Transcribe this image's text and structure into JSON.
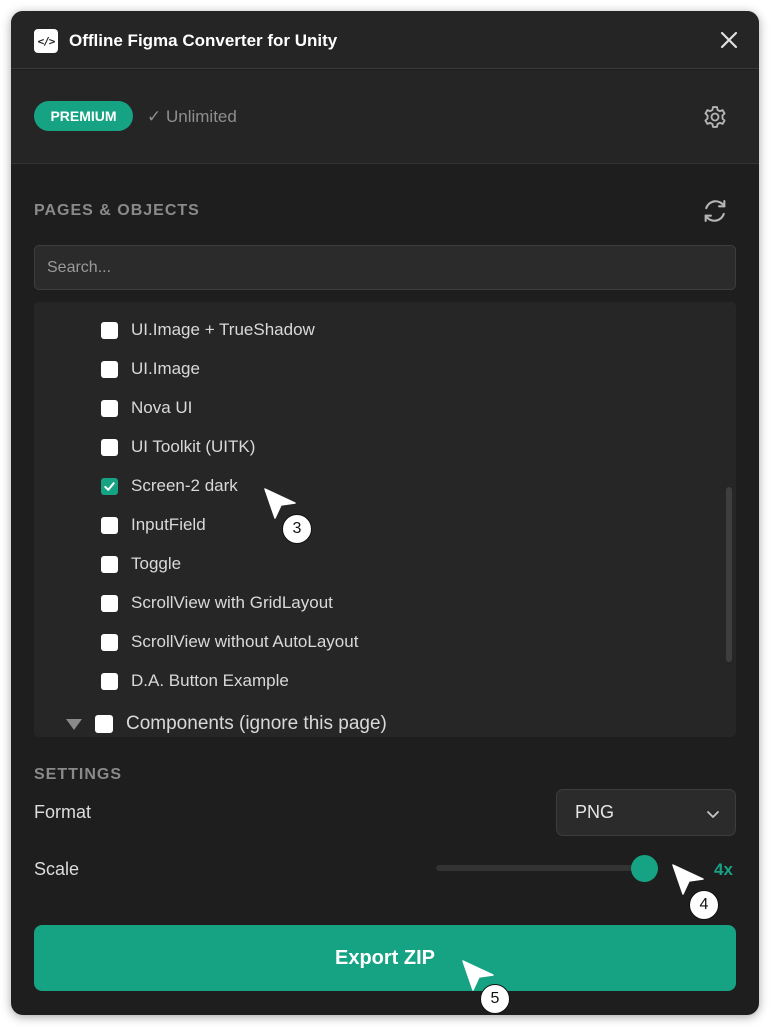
{
  "app": {
    "title": "Offline Figma Converter for Unity",
    "icon_glyph": "</>"
  },
  "license": {
    "badge": "PREMIUM",
    "status": "✓ Unlimited"
  },
  "pages_section": {
    "title": "PAGES & OBJECTS",
    "search_placeholder": "Search...",
    "items": [
      {
        "label": "UI.Image + TrueShadow",
        "checked": false
      },
      {
        "label": "UI.Image",
        "checked": false
      },
      {
        "label": "Nova UI",
        "checked": false
      },
      {
        "label": "UI Toolkit (UITK)",
        "checked": false
      },
      {
        "label": "Screen-2 dark",
        "checked": true
      },
      {
        "label": "InputField",
        "checked": false
      },
      {
        "label": "Toggle",
        "checked": false
      },
      {
        "label": "ScrollView with GridLayout",
        "checked": false
      },
      {
        "label": "ScrollView without AutoLayout",
        "checked": false
      },
      {
        "label": "D.A. Button Example",
        "checked": false
      }
    ],
    "group": {
      "label": "Components (ignore this page)",
      "checked": false,
      "expanded": true
    }
  },
  "settings": {
    "title": "SETTINGS",
    "format_label": "Format",
    "format_value": "PNG",
    "scale_label": "Scale",
    "scale_value": "4x",
    "scale_fraction": 1.0
  },
  "export": {
    "label": "Export ZIP"
  },
  "annotations": [
    {
      "number": "3"
    },
    {
      "number": "4"
    },
    {
      "number": "5"
    }
  ],
  "colors": {
    "accent": "#16a384",
    "background": "#1e1e1e",
    "panel": "#252525"
  },
  "icons": {
    "close": "close-icon",
    "settings": "gear-icon",
    "refresh": "refresh-icon",
    "dropdown": "chevron-down-icon",
    "expand": "triangle-down-icon",
    "check": "check-icon"
  }
}
